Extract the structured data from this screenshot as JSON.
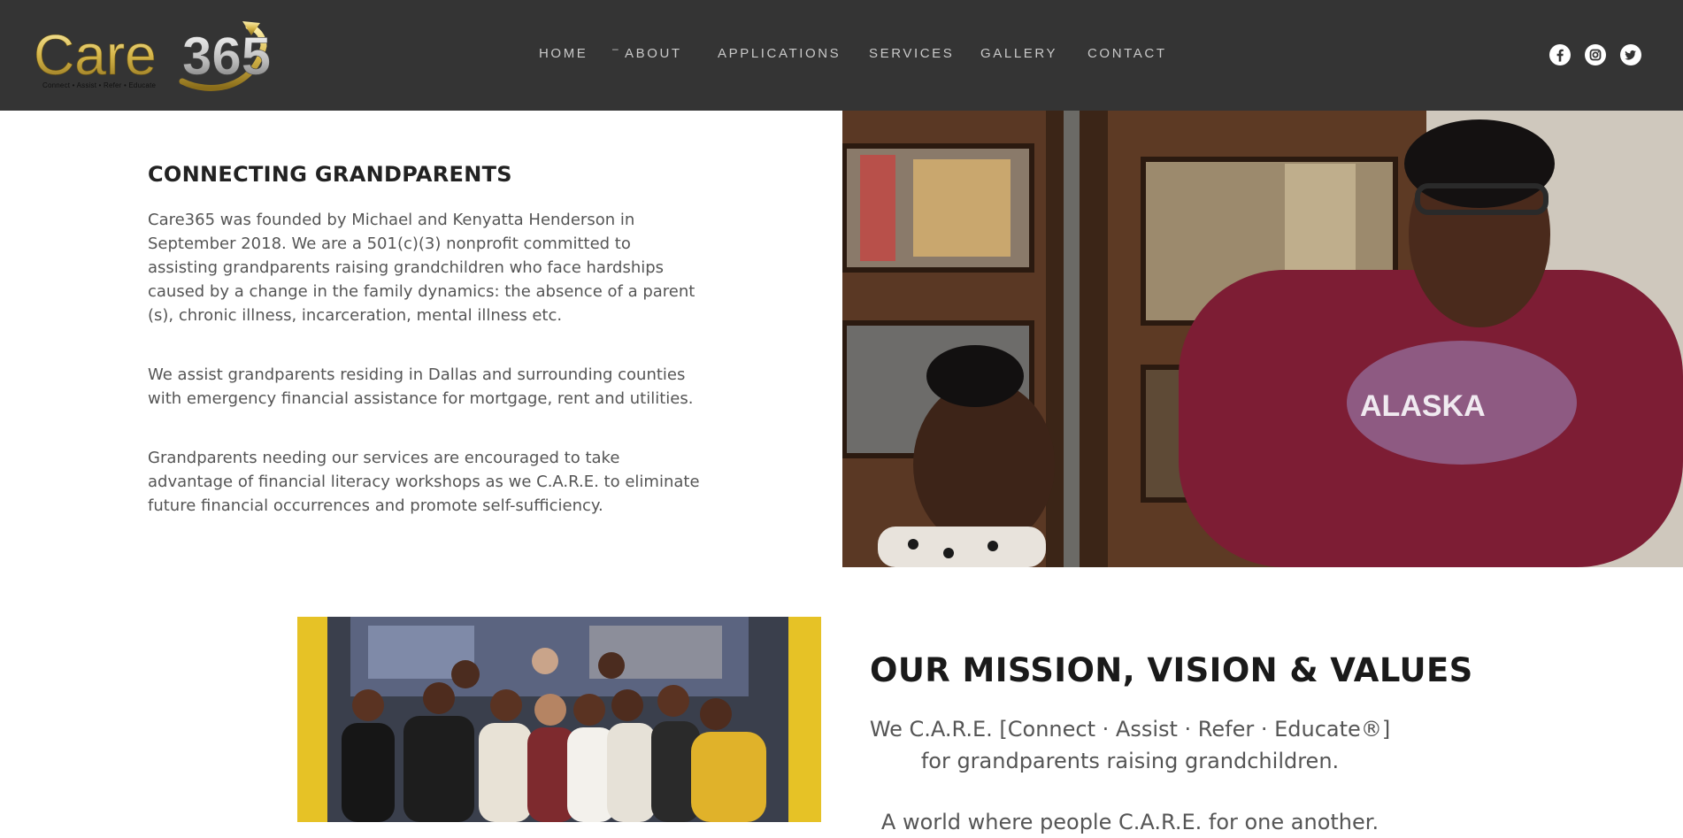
{
  "header": {
    "logo_text": "Care365",
    "logo_tagline": "Connect • Assist • Refer • Educate",
    "nav": [
      {
        "label": "HOME"
      },
      {
        "label": "ABOUT"
      },
      {
        "label": "APPLICATIONS"
      },
      {
        "label": "SERVICES"
      },
      {
        "label": "GALLERY"
      },
      {
        "label": "CONTACT"
      }
    ],
    "social": [
      {
        "icon": "facebook-icon"
      },
      {
        "icon": "instagram-icon"
      },
      {
        "icon": "twitter-icon"
      }
    ]
  },
  "intro": {
    "heading": "CONNECTING GRANDPARENTS",
    "paragraphs": [
      "Care365 was founded by Michael and Kenyatta Henderson in September 2018. We are a 501(c)(3) nonprofit committed to assisting grandparents raising grandchildren who face hardships caused by a change in the family dynamics: the absence of a parent (s), chronic illness, incarceration, mental illness etc.",
      "We assist grandparents residing in Dallas and surrounding counties with emergency financial assistance for mortgage, rent and utilities.",
      "Grandparents needing our services are encouraged to take advantage of financial literacy workshops as we C.A.R.E. to eliminate future financial occurrences and promote self-sufficiency."
    ]
  },
  "mission": {
    "heading": "OUR MISSION, VISION & VALUES",
    "mission_text": "We C.A.R.E. [Connect · Assist · Refer · Educate®] for grandparents raising grandchildren.",
    "vision_text": "A world where people C.A.R.E. for one another."
  },
  "colors": {
    "header_bg": "#343434",
    "nav_text": "#c9c9c9",
    "heading": "#222222",
    "body_text": "#555555",
    "logo_gold": "#d6b64a"
  }
}
